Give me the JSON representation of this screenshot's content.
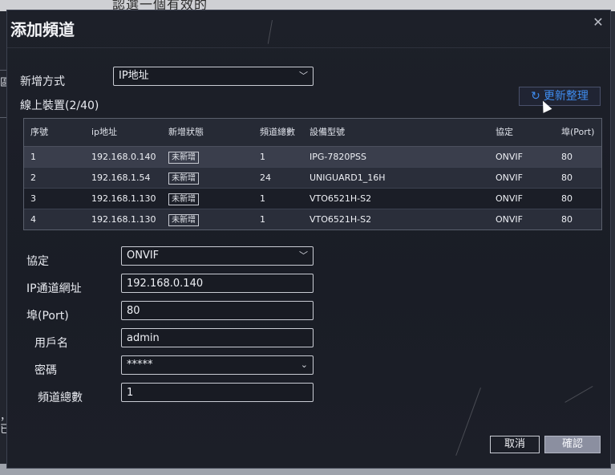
{
  "background": {
    "top_text": "認選一個有效的",
    "left_glyphs": [
      "區",
      "，已"
    ]
  },
  "dialog": {
    "title": "添加頻道",
    "close_icon": "close-icon"
  },
  "add_method": {
    "label": "新增方式",
    "value": "IP地址"
  },
  "online_devices": {
    "label": "線上裝置(2/40)"
  },
  "refresh_button": {
    "icon": "refresh-icon",
    "label": "更新整理"
  },
  "table": {
    "headers": [
      "序號",
      "ip地址",
      "新增狀態",
      "頻道總數",
      "設備型號",
      "協定",
      "埠(Port)"
    ],
    "rows": [
      {
        "no": "1",
        "ip": "192.168.0.140",
        "status": "未新增",
        "channels": "1",
        "model": "IPG-7820PSS",
        "protocol": "ONVIF",
        "port": "80"
      },
      {
        "no": "2",
        "ip": "192.168.1.54",
        "status": "未新增",
        "channels": "24",
        "model": "UNIGUARD1_16H",
        "protocol": "ONVIF",
        "port": "80"
      },
      {
        "no": "3",
        "ip": "192.168.1.130",
        "status": "未新增",
        "channels": "1",
        "model": "VTO6521H-S2",
        "protocol": "ONVIF",
        "port": "80"
      },
      {
        "no": "4",
        "ip": "192.168.1.130",
        "status": "未新增",
        "channels": "1",
        "model": "VTO6521H-S2",
        "protocol": "ONVIF",
        "port": "80"
      }
    ]
  },
  "form": {
    "protocol": {
      "label": "協定",
      "value": "ONVIF"
    },
    "ip": {
      "label": "IP通道網址",
      "value": "192.168.0.140"
    },
    "port": {
      "label": "埠(Port)",
      "value": "80"
    },
    "username": {
      "label": "用戶名",
      "value": "admin"
    },
    "password": {
      "label": "密碼",
      "value": "*****"
    },
    "channel_count": {
      "label": "頻道總數",
      "value": "1"
    }
  },
  "buttons": {
    "cancel": "取消",
    "confirm": "確認"
  },
  "colors": {
    "dialog_bg": "#1c1f28",
    "accent_blue": "#3f8df0",
    "confirm_bg": "#8b8fa0"
  }
}
